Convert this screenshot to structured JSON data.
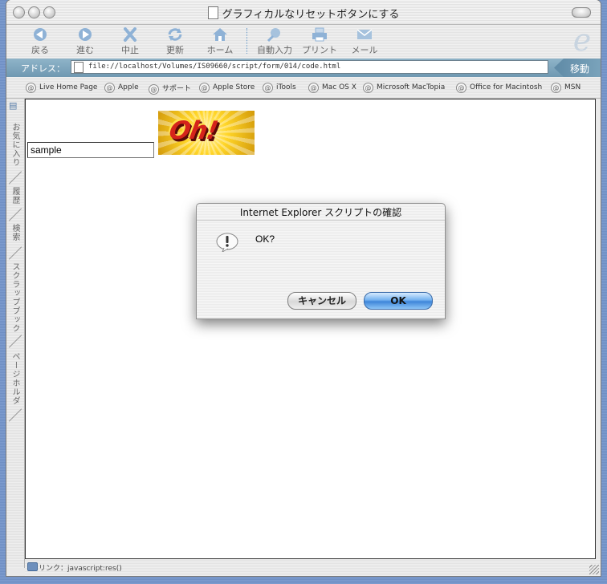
{
  "window": {
    "title": "グラフィカルなリセットボタンにする"
  },
  "toolbar": {
    "buttons": [
      {
        "label": "戻る",
        "icon": "back-arrow-icon"
      },
      {
        "label": "進む",
        "icon": "forward-arrow-icon"
      },
      {
        "label": "中止",
        "icon": "stop-x-icon"
      },
      {
        "label": "更新",
        "icon": "refresh-icon"
      },
      {
        "label": "ホーム",
        "icon": "home-icon"
      },
      {
        "label": "自動入力",
        "icon": "autofill-pen-icon"
      },
      {
        "label": "プリント",
        "icon": "printer-icon"
      },
      {
        "label": "メール",
        "icon": "mail-envelope-icon"
      }
    ]
  },
  "address": {
    "label": "アドレス：",
    "url": "file://localhost/Volumes/IS09660/script/form/014/code.html",
    "go_label": "移動"
  },
  "favorites": [
    "Live Home Page",
    "Apple",
    "サポート",
    "Apple Store",
    "iTools",
    "Mac OS X",
    "Microsoft MacTopia",
    "Office for Macintosh",
    "MSN"
  ],
  "sidebar_tabs": [
    "お気に入り",
    "履歴",
    "検索",
    "スクラップブック",
    "ページホルダ"
  ],
  "page": {
    "input_value": "sample",
    "image_text": "Oh!"
  },
  "status": {
    "text": "リンク：javascript:res()"
  },
  "dialog": {
    "title": "Internet Explorer スクリプトの確認",
    "message": "OK?",
    "cancel_label": "キャンセル",
    "ok_label": "OK"
  },
  "colors": {
    "desktop": "#7c9bce",
    "address_bar": "#7aa3bb",
    "ok_button": "#3e86d9",
    "oh_text": "#d5241b"
  }
}
